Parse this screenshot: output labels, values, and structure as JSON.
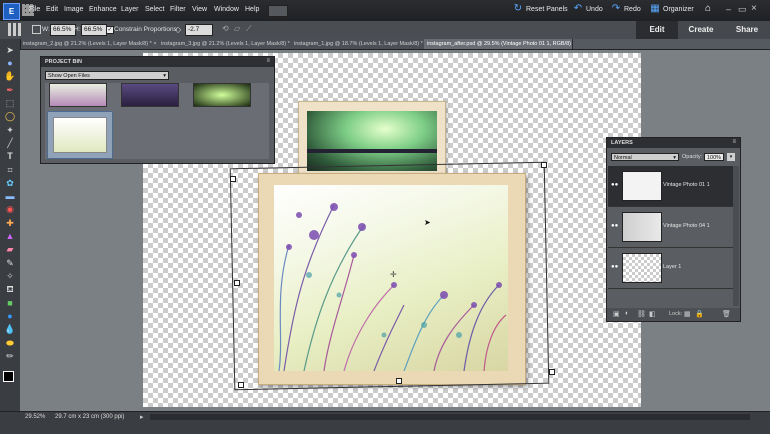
{
  "menu": {
    "logo": "E",
    "items": [
      "File",
      "Edit",
      "Image",
      "Enhance",
      "Layer",
      "Select",
      "Filter",
      "View",
      "Window",
      "Help"
    ],
    "reset_panels": "Reset Panels",
    "undo": "Undo",
    "redo": "Redo",
    "organizer": "Organizer"
  },
  "options": {
    "w_label": "W:",
    "w_value": "66.5%",
    "h_label": "H:",
    "h_value": "66.5%",
    "constrain_label": "Constrain Proportions",
    "angle_value": "-2.7"
  },
  "mode_tabs": [
    "Edit",
    "Create",
    "Share"
  ],
  "doc_tabs": [
    "instagram_2.jpg @ 21.2% (Levels 1, Layer Mask/8) *",
    "instagram_3.jpg @ 21.2% (Levels 1, Layer Mask/8) *",
    "instagram_1.jpg @ 18.7% (Levels 1, Layer Mask/8) *",
    "instagram_after.psd @ 29.5% (Vintage Photo 01 1, RGB/8) *"
  ],
  "project_bin": {
    "title": "PROJECT BIN",
    "dropdown": "Show Open Files"
  },
  "layers_panel": {
    "title": "LAYERS",
    "blend_mode": "Normal",
    "opacity_label": "Opacity:",
    "opacity_value": "100%",
    "lock_label": "Lock:",
    "layers": [
      {
        "name": "Vintage Photo 01 1"
      },
      {
        "name": "Vintage Photo 04 1"
      },
      {
        "name": "Layer 1"
      }
    ]
  },
  "status": {
    "zoom": "29.52%",
    "doc_size": "29.7 cm x 23 cm (300 ppi)"
  },
  "colors": {
    "accent": "#1e5fbf",
    "workspace": "#7b8084"
  }
}
